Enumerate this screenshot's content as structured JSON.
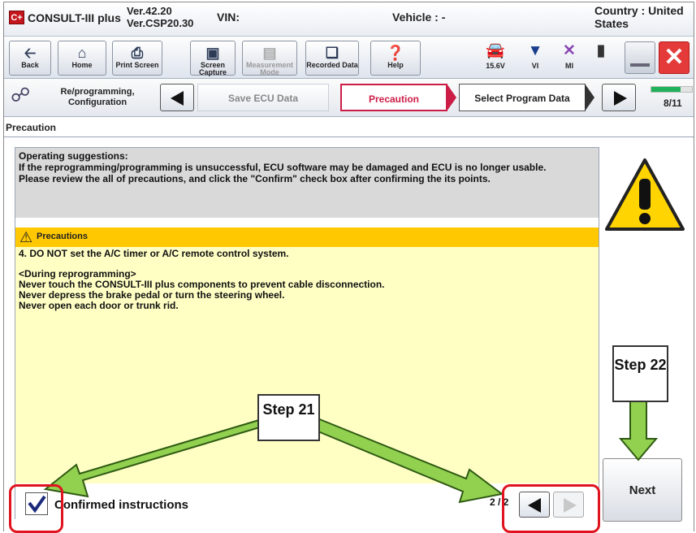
{
  "title_bar": {
    "app_name": "CONSULT-III plus",
    "version_line1": "Ver.42.20",
    "version_line2": "Ver.CSP20.30",
    "vin_label": "VIN:",
    "vehicle_label": "Vehicle : -",
    "country_label": "Country : United States"
  },
  "toolbar": {
    "buttons": [
      {
        "label": "Back",
        "icon": "back-arrow-icon"
      },
      {
        "label": "Home",
        "icon": "home-icon"
      },
      {
        "label": "Print Screen",
        "icon": "printer-icon"
      },
      {
        "label": "Screen Capture",
        "icon": "camera-icon"
      },
      {
        "label": "Measurement Mode",
        "icon": "measurement-icon"
      },
      {
        "label": "Recorded Data",
        "icon": "recorded-data-icon"
      },
      {
        "label": "Help",
        "icon": "help-icon"
      }
    ],
    "status": {
      "voltage": "15.6V",
      "vi_label": "VI",
      "mi_label": "MI"
    }
  },
  "nav": {
    "section_label": "Re/programming, Configuration",
    "steps": [
      "Save ECU Data",
      "Precaution",
      "Select Program Data"
    ],
    "active_step": "Precaution",
    "progress_text": "8/11",
    "progress_fraction": 0.727
  },
  "page": {
    "title": "Precaution",
    "suggestions_heading": "Operating suggestions:",
    "suggestions_line1": "If the reprogramming/programming is unsuccessful, ECU software may be damaged and ECU is no longer usable.",
    "suggestions_line2": "Please review the all of precautions, and click the \"Confirm\" check box after confirming the its points.",
    "precautions_header": "Precautions",
    "precautions_lines": [
      "4. DO NOT set the A/C timer or A/C remote control system.",
      "",
      "<During  reprogramming>",
      "Never touch the CONSULT-III plus components to prevent cable disconnection.",
      "Never depress the brake pedal or turn the steering wheel.",
      "Never open each door or trunk rid."
    ],
    "confirm_label": "Confirmed instructions",
    "confirm_checked": true,
    "page_indicator": "2 / 2",
    "next_label": "Next"
  },
  "annotations": {
    "step21": "Step 21",
    "step22": "Step 22",
    "arrow_color": "#92d050",
    "highlight_color": "#e0141e"
  }
}
